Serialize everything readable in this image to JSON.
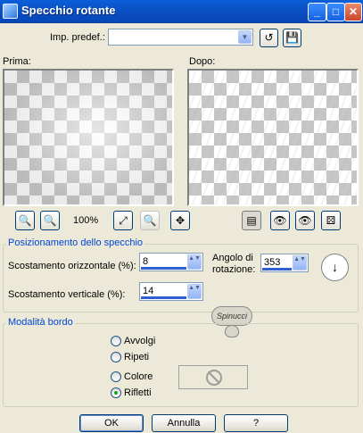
{
  "window": {
    "title": "Specchio rotante",
    "min_glyph": "_",
    "max_glyph": "□",
    "close_glyph": "✕"
  },
  "preset": {
    "label": "Imp. predef.:",
    "value": "",
    "arrow_glyph": "▼",
    "reset_glyph": "↺",
    "save_glyph": "💾"
  },
  "previews": {
    "before_label": "Prima:",
    "after_label": "Dopo:"
  },
  "toolbar": {
    "zoom_out_glyph": "🔍",
    "zoom_in_glyph": "🔍",
    "zoom_level": "100%",
    "fit_glyph": "⤢",
    "locate_glyph": "🔍",
    "pan_glyph": "✥",
    "overlay_glyph": "▤",
    "eye1_glyph": "👁",
    "eye2_glyph": "👁",
    "random_glyph": "⚄"
  },
  "mirror": {
    "group_title": "Posizionamento dello specchio",
    "horiz_label": "Scostamento orizzontale (%):",
    "horiz_value": "8",
    "vert_label": "Scostamento verticale (%):",
    "vert_value": "14",
    "angle_label_1": "Angolo di",
    "angle_label_2": "rotazione:",
    "angle_value": "353",
    "dial_glyph": "↓",
    "spin_glyph": "▲▼",
    "drop_glyph": "▼"
  },
  "watermark": {
    "text": "Spinucci"
  },
  "edge": {
    "group_title": "Modalità bordo",
    "options": [
      {
        "label": "Avvolgi",
        "checked": false
      },
      {
        "label": "Ripeti",
        "checked": false
      },
      {
        "label": "Colore",
        "checked": false
      },
      {
        "label": "Rifletti",
        "checked": true
      }
    ]
  },
  "buttons": {
    "ok": "OK",
    "cancel": "Annulla",
    "help": "?"
  }
}
